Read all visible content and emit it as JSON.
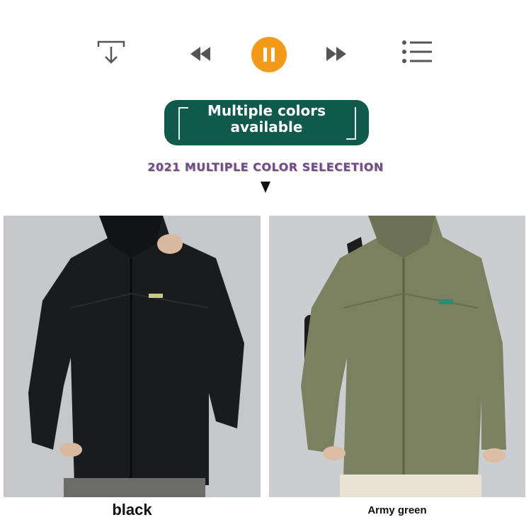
{
  "toolbar": {
    "icons": [
      "download-icon",
      "rewind-icon",
      "pause-icon",
      "fast-forward-icon",
      "playlist-icon"
    ],
    "accent_color": "#f39a1a",
    "icon_color": "#555555"
  },
  "banner": {
    "line1": "Multiple colors",
    "line2": "available",
    "color": "#0f5a4d"
  },
  "subtitle": "2021 MULTIPLE COLOR SELECETION",
  "products": [
    {
      "color_name": "black",
      "jacket_color": "#1a1b1d"
    },
    {
      "color_name": "Army green",
      "jacket_color": "#7a8060"
    }
  ]
}
